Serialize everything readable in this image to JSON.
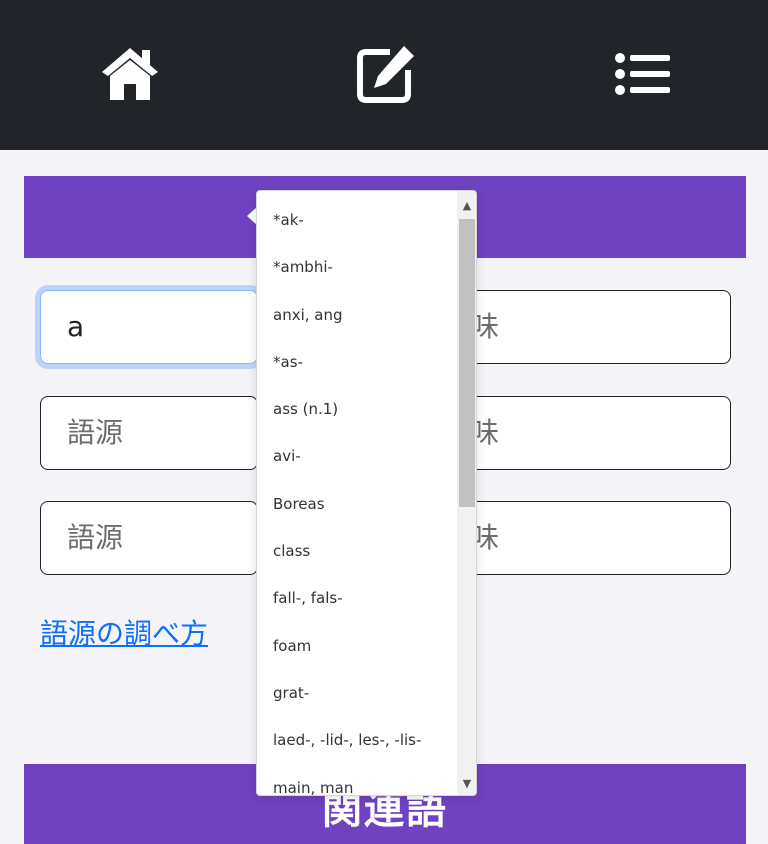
{
  "nav": {
    "icons": [
      "home-icon",
      "edit-icon",
      "list-icon"
    ]
  },
  "form": {
    "fields": [
      {
        "left_value": "a",
        "right_placeholder": "味"
      },
      {
        "left_placeholder": "語源",
        "right_placeholder": "味"
      },
      {
        "left_placeholder": "語源",
        "right_placeholder": "味"
      }
    ],
    "help_link": "語源の調べ方",
    "related_label": "関連語"
  },
  "dropdown": {
    "items": [
      "*ak-",
      "*ambhi-",
      "anxi, ang",
      "*as-",
      "ass (n.1)",
      "avi-",
      "Boreas",
      "class",
      "fall-, fals-",
      "foam",
      "grat-",
      "laed-, -lid-, les-, -lis-",
      "main, man"
    ]
  },
  "colors": {
    "navbar": "#212529",
    "accent": "#6f42c1",
    "link": "#0d6efd",
    "focus": "#86b7fe"
  }
}
